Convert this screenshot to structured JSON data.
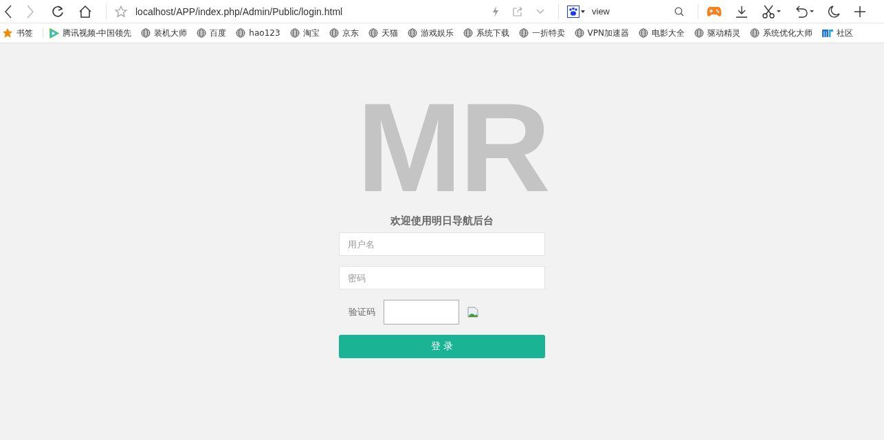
{
  "browser": {
    "url": "localhost/APP/index.php/Admin/Public/login.html",
    "search_engine": "view"
  },
  "bookmarks": [
    {
      "kind": "star",
      "label": "书签"
    },
    {
      "kind": "video",
      "label": "腾讯视频-中国领先"
    },
    {
      "kind": "globe",
      "label": "装机大师"
    },
    {
      "kind": "globe",
      "label": "百度"
    },
    {
      "kind": "globe",
      "label": "hao123"
    },
    {
      "kind": "globe",
      "label": "淘宝"
    },
    {
      "kind": "globe",
      "label": "京东"
    },
    {
      "kind": "globe",
      "label": "天猫"
    },
    {
      "kind": "globe",
      "label": "游戏娱乐"
    },
    {
      "kind": "globe",
      "label": "系统下载"
    },
    {
      "kind": "globe",
      "label": "一折特卖"
    },
    {
      "kind": "globe",
      "label": "VPN加速器"
    },
    {
      "kind": "globe",
      "label": "电影大全"
    },
    {
      "kind": "globe",
      "label": "驱动精灵"
    },
    {
      "kind": "globe",
      "label": "系统优化大师"
    },
    {
      "kind": "mr",
      "label": "社区"
    }
  ],
  "login": {
    "logo": "MR",
    "title": "欢迎使用明日导航后台",
    "username": {
      "placeholder": "用户名"
    },
    "password": {
      "placeholder": "密码"
    },
    "captcha_label": "验证码",
    "submit": "登 录"
  }
}
